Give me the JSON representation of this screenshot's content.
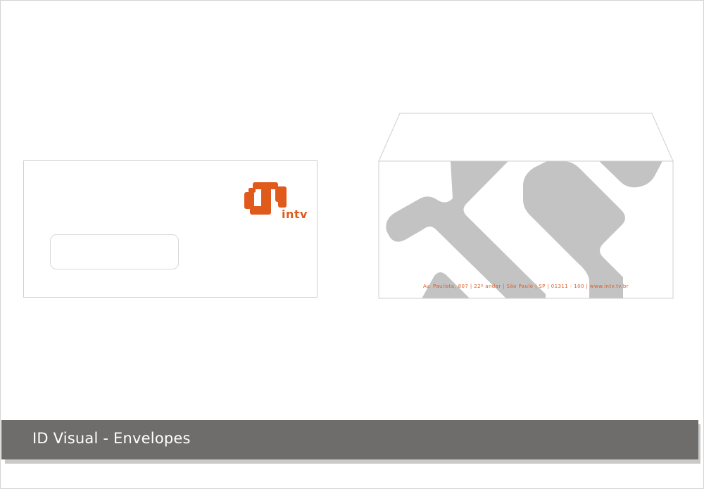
{
  "logo": {
    "icon": "intv-logo-icon",
    "text": "intv",
    "color": "#e05a1c"
  },
  "envelope_back": {
    "address": "Av. Paulista, 807  |  22º andar  |  São Paulo  |  SP  |  01311 - 100  |  www.intv.tv.br",
    "pattern_color": "#c3c3c3"
  },
  "caption": {
    "title": "ID Visual - Envelopes",
    "bar_color": "#6f6d6b"
  }
}
